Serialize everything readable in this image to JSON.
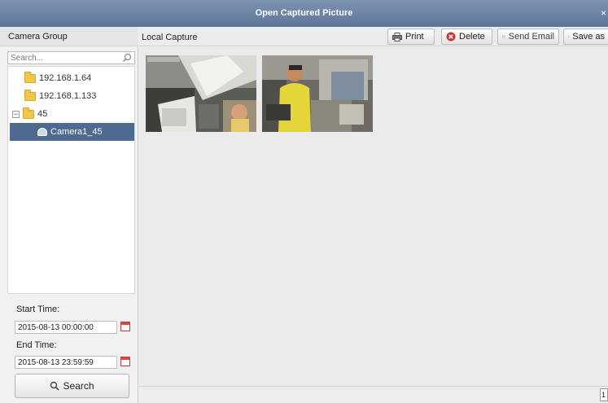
{
  "window": {
    "title": "Open Captured Picture",
    "close_glyph": "×"
  },
  "left_panel": {
    "header": "Camera Group",
    "search": {
      "placeholder": "Search...",
      "value": ""
    },
    "tree": [
      {
        "label": "192.168.1.64",
        "icon": "folder-icon"
      },
      {
        "label": "192.168.1.133",
        "icon": "folder-icon"
      },
      {
        "label": "45",
        "icon": "folder-icon",
        "expanded": true
      },
      {
        "label": "Camera1_45",
        "icon": "camera-icon",
        "selected": true
      }
    ],
    "start_time": {
      "label": "Start Time:",
      "value": "2015-08-13 00:00:00"
    },
    "end_time": {
      "label": "End Time:",
      "value": "2015-08-13 23:59:59"
    },
    "search_button": "Search"
  },
  "main": {
    "header": "Local Capture",
    "toolbar": {
      "print": "Print",
      "delete": "Delete",
      "send_email": "Send Email",
      "save_as": "Save as"
    },
    "thumbnails": [
      {
        "name": "capture-thumbnail-1"
      },
      {
        "name": "capture-thumbnail-2"
      }
    ],
    "page_number": "1"
  },
  "colors": {
    "title_bar": "#6b809f",
    "selection": "#4e6a8f",
    "delete_icon": "#c63a3a",
    "folder": "#f0c74a"
  }
}
